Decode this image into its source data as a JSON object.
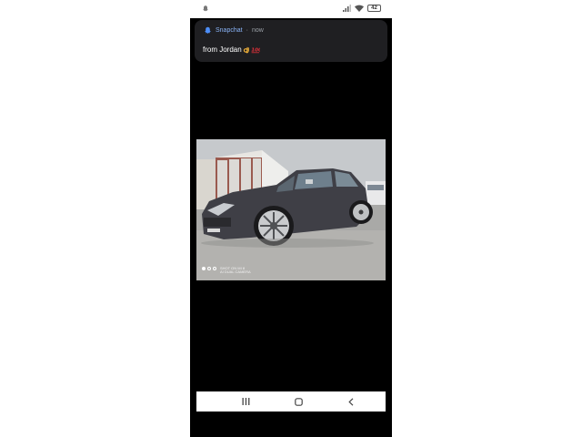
{
  "status_bar": {
    "battery_level": "42",
    "icons": [
      "snapchat-ghost-icon",
      "signal-icon",
      "wifi-icon",
      "battery-icon"
    ]
  },
  "notification": {
    "app_name": "Snapchat",
    "separator": "·",
    "time": "now",
    "message": "from Jordan",
    "emojis": [
      "ok-hand-emoji-icon",
      "hundred-points-emoji-icon"
    ]
  },
  "photo": {
    "watermark_line1": "SHOT ON MI 8",
    "watermark_line2": "AI DUAL CAMERA",
    "pager_dots": 3,
    "active_dot": 0
  },
  "nav_bar": {
    "buttons": [
      "recent-apps-icon",
      "home-icon",
      "back-icon"
    ]
  },
  "colors": {
    "notification_bg": "#1f1f22",
    "app_name": "#8ab4f8",
    "meta_text": "#9aa0a6",
    "screen_bg": "#000000"
  }
}
